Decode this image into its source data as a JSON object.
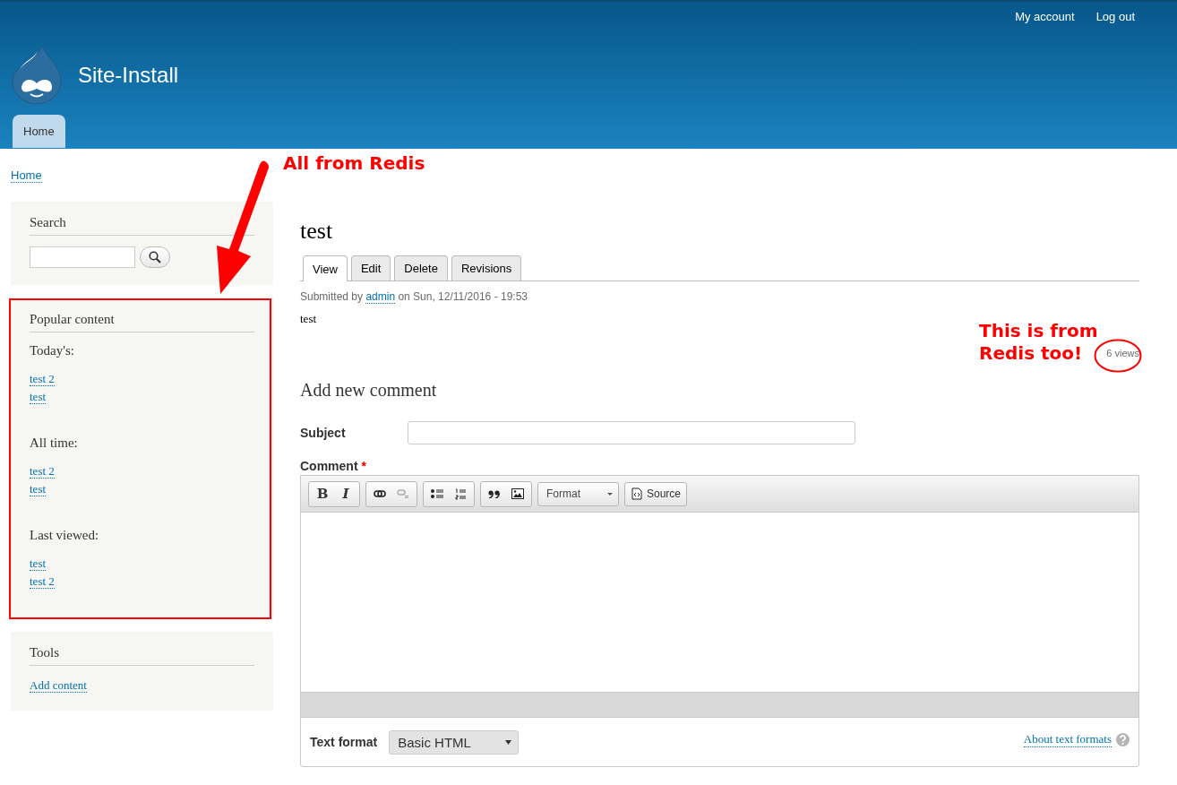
{
  "header": {
    "top_links": [
      "My account",
      "Log out"
    ],
    "site_name": "Site-Install",
    "nav_tabs": [
      {
        "label": "Home",
        "selected": true
      }
    ]
  },
  "breadcrumb": [
    "Home"
  ],
  "sidebar": {
    "search": {
      "title": "Search"
    },
    "popular": {
      "title": "Popular content",
      "sections": [
        {
          "heading": "Today's:",
          "links": [
            "test 2",
            "test"
          ]
        },
        {
          "heading": "All time:",
          "links": [
            "test 2",
            "test"
          ]
        },
        {
          "heading": "Last viewed:",
          "links": [
            "test",
            "test 2"
          ]
        }
      ]
    },
    "tools": {
      "title": "Tools",
      "links": [
        "Add content"
      ]
    }
  },
  "node": {
    "title": "test",
    "tabs": [
      {
        "label": "View",
        "selected": true
      },
      {
        "label": "Edit",
        "selected": false
      },
      {
        "label": "Delete",
        "selected": false
      },
      {
        "label": "Revisions",
        "selected": false
      }
    ],
    "submitted_prefix": "Submitted by",
    "author": "admin",
    "submitted_date": "on Sun, 12/11/2016 - 19:53",
    "body": "test",
    "views": "6 views"
  },
  "comment_form": {
    "heading": "Add new comment",
    "subject_label": "Subject",
    "comment_label": "Comment",
    "required_mark": "*",
    "toolbar": [
      {
        "buttons": [
          {
            "kind": "bold",
            "label": "B",
            "disabled": false
          },
          {
            "kind": "italic",
            "label": "I",
            "disabled": false
          }
        ]
      },
      {
        "buttons": [
          {
            "kind": "link",
            "disabled": false
          },
          {
            "kind": "unlink",
            "disabled": true
          }
        ]
      },
      {
        "buttons": [
          {
            "kind": "bulleted-list",
            "disabled": false
          },
          {
            "kind": "numbered-list",
            "disabled": false
          }
        ]
      },
      {
        "buttons": [
          {
            "kind": "blockquote",
            "disabled": false
          },
          {
            "kind": "image",
            "disabled": false
          }
        ]
      }
    ],
    "format_dropdown": "Format",
    "source_button": "Source",
    "text_format_label": "Text format",
    "text_format_value": "Basic HTML",
    "about_link": "About text formats"
  },
  "annotations": [
    {
      "kind": "arrow",
      "text": "All from Redis"
    },
    {
      "kind": "circle",
      "text": "This is from Redis too!"
    }
  ]
}
